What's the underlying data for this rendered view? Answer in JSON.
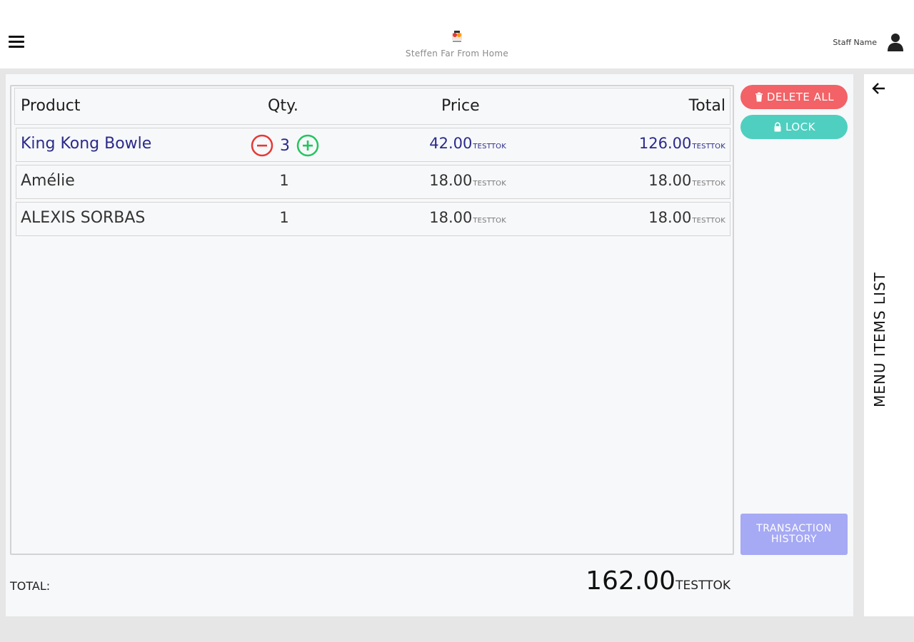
{
  "header": {
    "brand_name": "Steffen Far From Home",
    "staff_name": "Staff Name"
  },
  "table": {
    "columns": [
      "Product",
      "Qty.",
      "Price",
      "Total"
    ],
    "currency": "TESTTOK",
    "rows": [
      {
        "name": "King Kong Bowle",
        "qty": "3",
        "price": "42.00",
        "total": "126.00",
        "selected": true
      },
      {
        "name": "Amélie",
        "qty": "1",
        "price": "18.00",
        "total": "18.00",
        "selected": false
      },
      {
        "name": "ALEXIS SORBAS",
        "qty": "1",
        "price": "18.00",
        "total": "18.00",
        "selected": false
      }
    ]
  },
  "actions": {
    "delete_all": "DELETE ALL",
    "lock": "LOCK",
    "history_line1": "TRANSACTION",
    "history_line2": "HISTORY"
  },
  "summary": {
    "label": "TOTAL:",
    "value": "162.00",
    "currency": "TESTTOK"
  },
  "side_panel": {
    "label": "MENU ITEMS LIST"
  },
  "colors": {
    "selected_text": "#2b2a8a",
    "delete": "#f26266",
    "lock": "#4fcfc0",
    "history": "#a6a9f4",
    "minus": "#e53935",
    "plus": "#22c55e"
  }
}
